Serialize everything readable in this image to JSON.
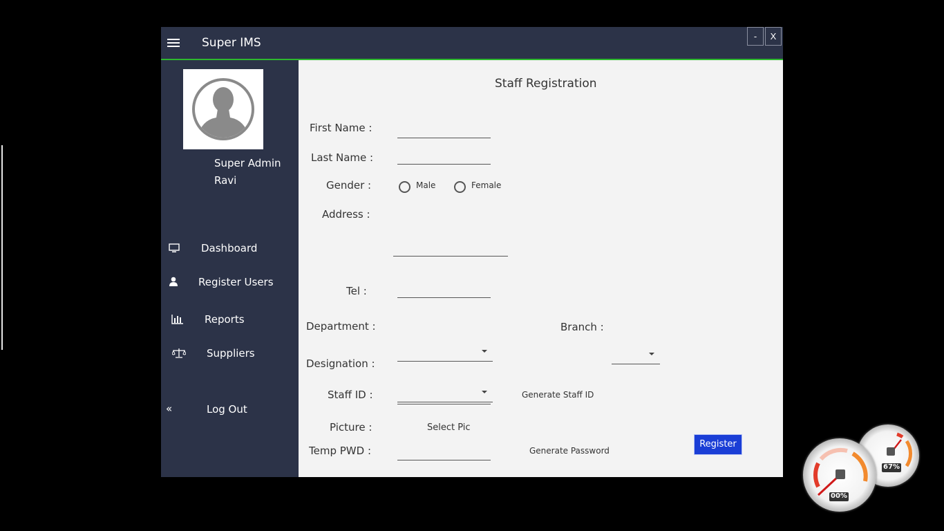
{
  "app": {
    "title": "Super IMS",
    "minimize_label": "-",
    "close_label": "X"
  },
  "sidebar": {
    "user_role": "Super Admin",
    "user_name": "Ravi",
    "nav": [
      {
        "label": "Dashboard",
        "icon": "monitor-icon"
      },
      {
        "label": "Register Users",
        "icon": "user-icon"
      },
      {
        "label": "Reports",
        "icon": "bar-chart-icon"
      },
      {
        "label": "Suppliers",
        "icon": "scale-icon"
      },
      {
        "label": "Log Out",
        "icon": "double-chevron-left-icon"
      }
    ]
  },
  "form": {
    "title": "Staff Registration",
    "first_name_label": "First Name :",
    "last_name_label": "Last Name :",
    "gender_label": "Gender :",
    "gender_options": [
      "Male",
      "Female"
    ],
    "address_label": "Address :",
    "tel_label": "Tel :",
    "department_label": "Department :",
    "branch_label": "Branch :",
    "designation_label": "Designation :",
    "staff_id_label": "Staff ID :",
    "generate_staff_id": "Generate Staff ID",
    "picture_label": "Picture :",
    "select_pic": "Select Pic",
    "temp_pwd_label": "Temp PWD :",
    "generate_password": "Generate Password",
    "register_button": "Register"
  },
  "gauges": {
    "cpu_reading": "00%",
    "memory_reading": "67%"
  },
  "colors": {
    "sidebar_bg": "#2c3348",
    "accent_line": "#2eb82e",
    "register_button": "#1a3ed6",
    "content_bg": "#f3f3f3"
  }
}
